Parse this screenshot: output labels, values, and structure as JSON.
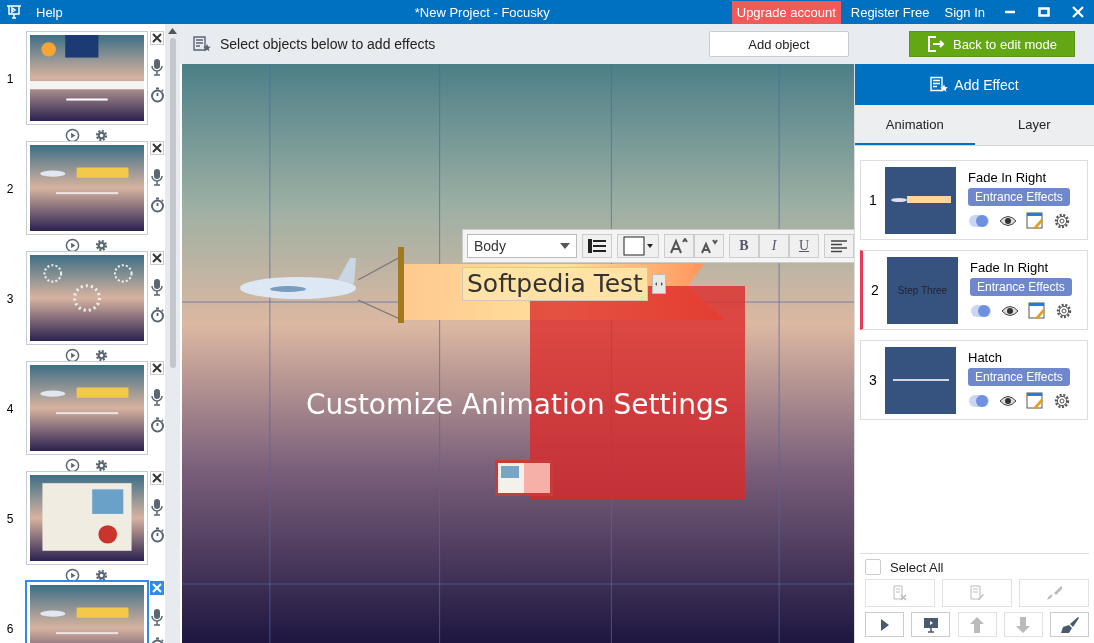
{
  "app": {
    "menu": "Help",
    "title": "*New Project - Focusky",
    "upgrade": "Upgrade account",
    "register": "Register Free",
    "sign_in": "Sign In"
  },
  "toolbar": {
    "hint": "Select objects below to add effects",
    "add_object": "Add object",
    "back": "Back to edit mode"
  },
  "slides": [
    {
      "number": "1",
      "selected": false
    },
    {
      "number": "2",
      "selected": false
    },
    {
      "number": "3",
      "selected": false
    },
    {
      "number": "4",
      "selected": false
    },
    {
      "number": "5",
      "selected": false
    },
    {
      "number": "6",
      "selected": true
    }
  ],
  "canvas": {
    "banner_text": "Softpedia Test",
    "caption": "Customize Animation Settings",
    "format_bar": {
      "style": "Body",
      "bold": "B",
      "italic": "I",
      "underline": "U"
    }
  },
  "effects_panel": {
    "header": "Add Effect",
    "tabs": [
      {
        "label": "Animation",
        "selected": true
      },
      {
        "label": "Layer",
        "selected": false
      }
    ],
    "effects": [
      {
        "number": "1",
        "name": "Fade In Right",
        "category": "Entrance Effects",
        "selected": false
      },
      {
        "number": "2",
        "name": "Fade In Right",
        "category": "Entrance Effects",
        "selected": true,
        "thumb_text": "Step Three"
      },
      {
        "number": "3",
        "name": "Hatch",
        "category": "Entrance Effects",
        "selected": false
      }
    ],
    "select_all": {
      "label": "Select All",
      "checked": false
    }
  }
}
